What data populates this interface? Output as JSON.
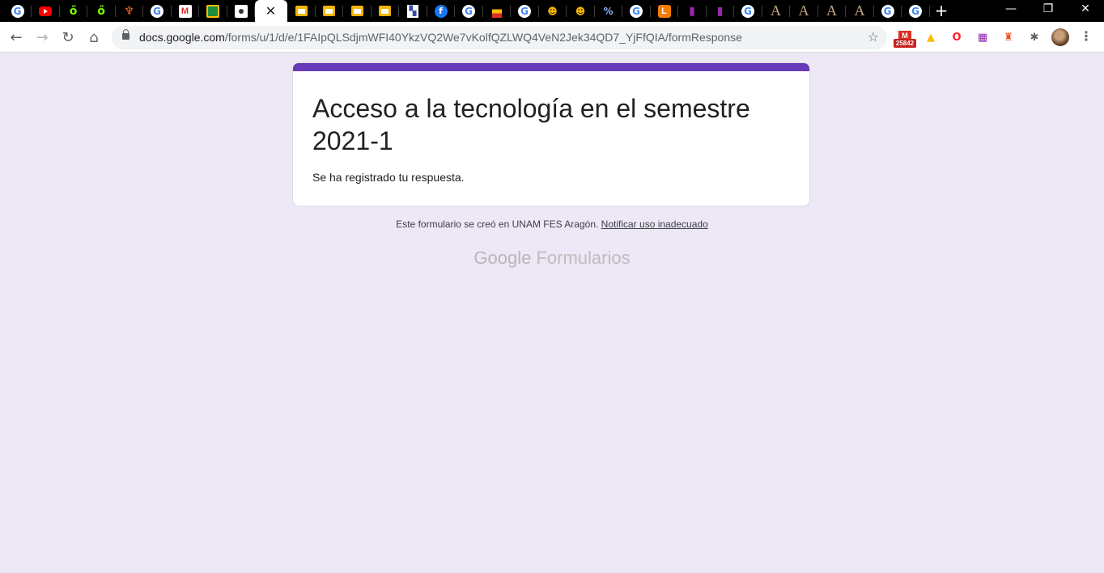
{
  "browser": {
    "tabs": [
      {
        "icon": "google-icon",
        "glyph": "G"
      },
      {
        "icon": "youtube-icon",
        "glyph": ""
      },
      {
        "icon": "lime-icon",
        "glyph": "ő"
      },
      {
        "icon": "lime-icon",
        "glyph": "ő"
      },
      {
        "icon": "gitlab-icon",
        "glyph": "♆"
      },
      {
        "icon": "google-icon",
        "glyph": "G"
      },
      {
        "icon": "gmail-icon",
        "glyph": "M"
      },
      {
        "icon": "classroom-icon",
        "glyph": ""
      },
      {
        "icon": "account-icon",
        "glyph": ""
      },
      {
        "icon": "active-tab-close-icon",
        "glyph": "✕",
        "active": true
      },
      {
        "icon": "slides-icon",
        "glyph": ""
      },
      {
        "icon": "slides-icon",
        "glyph": ""
      },
      {
        "icon": "slides-icon",
        "glyph": ""
      },
      {
        "icon": "slides-icon",
        "glyph": ""
      },
      {
        "icon": "flag-icon",
        "glyph": "▚"
      },
      {
        "icon": "facebook-icon",
        "glyph": "f"
      },
      {
        "icon": "google-icon",
        "glyph": "G"
      },
      {
        "icon": "flag-icon",
        "glyph": ""
      },
      {
        "icon": "google-icon",
        "glyph": "G"
      },
      {
        "icon": "cat-icon",
        "glyph": "☻"
      },
      {
        "icon": "cat-icon",
        "glyph": "☻"
      },
      {
        "icon": "percent-icon",
        "glyph": "%"
      },
      {
        "icon": "google-icon",
        "glyph": "G"
      },
      {
        "icon": "orange-l-icon",
        "glyph": "L"
      },
      {
        "icon": "purple-book-icon",
        "glyph": "▮"
      },
      {
        "icon": "purple-book-icon",
        "glyph": "▮"
      },
      {
        "icon": "google-icon",
        "glyph": "G"
      },
      {
        "icon": "serif-a-icon",
        "glyph": "A"
      },
      {
        "icon": "serif-a-icon",
        "glyph": "A"
      },
      {
        "icon": "serif-a-icon",
        "glyph": "A"
      },
      {
        "icon": "serif-a-icon",
        "glyph": "A"
      },
      {
        "icon": "google-icon",
        "glyph": "G"
      },
      {
        "icon": "google-icon",
        "glyph": "G"
      }
    ],
    "new_tab": "+",
    "window_controls": {
      "minimize": "—",
      "restore": "❐",
      "close": "✕"
    },
    "nav": {
      "back": "←",
      "forward": "→",
      "reload": "↻",
      "home": "⌂"
    },
    "url_host": "docs.google.com",
    "url_path": "/forms/u/1/d/e/1FAIpQLSdjmWFI40YkzVQ2We7vKolfQZLWQ4VeN2Jek34QD7_YjFfQIA/formResponse",
    "bookmark_star": "☆",
    "extensions": {
      "gmail_letter": "M",
      "gmail_count": "25842",
      "drive": "▲",
      "opera": "O",
      "puzzle_grid": "▦",
      "orange_ext": "♜",
      "puzzle": "✱",
      "menu": "⋮"
    },
    "accent_colors": {
      "gmail": "#d93025",
      "drive": "#fbbc04",
      "opera": "#ff1b2d"
    }
  },
  "form": {
    "accent": "#673ab7",
    "title": "Acceso a la tecnología en el semestre 2021-1",
    "confirmation": "Se ha registrado tu respuesta.",
    "footer_text": "Este formulario se creó en UNAM FES Aragón.",
    "report_link": "Notificar uso inadecuado",
    "brand_google": "Google",
    "brand_product": "Formularios"
  }
}
